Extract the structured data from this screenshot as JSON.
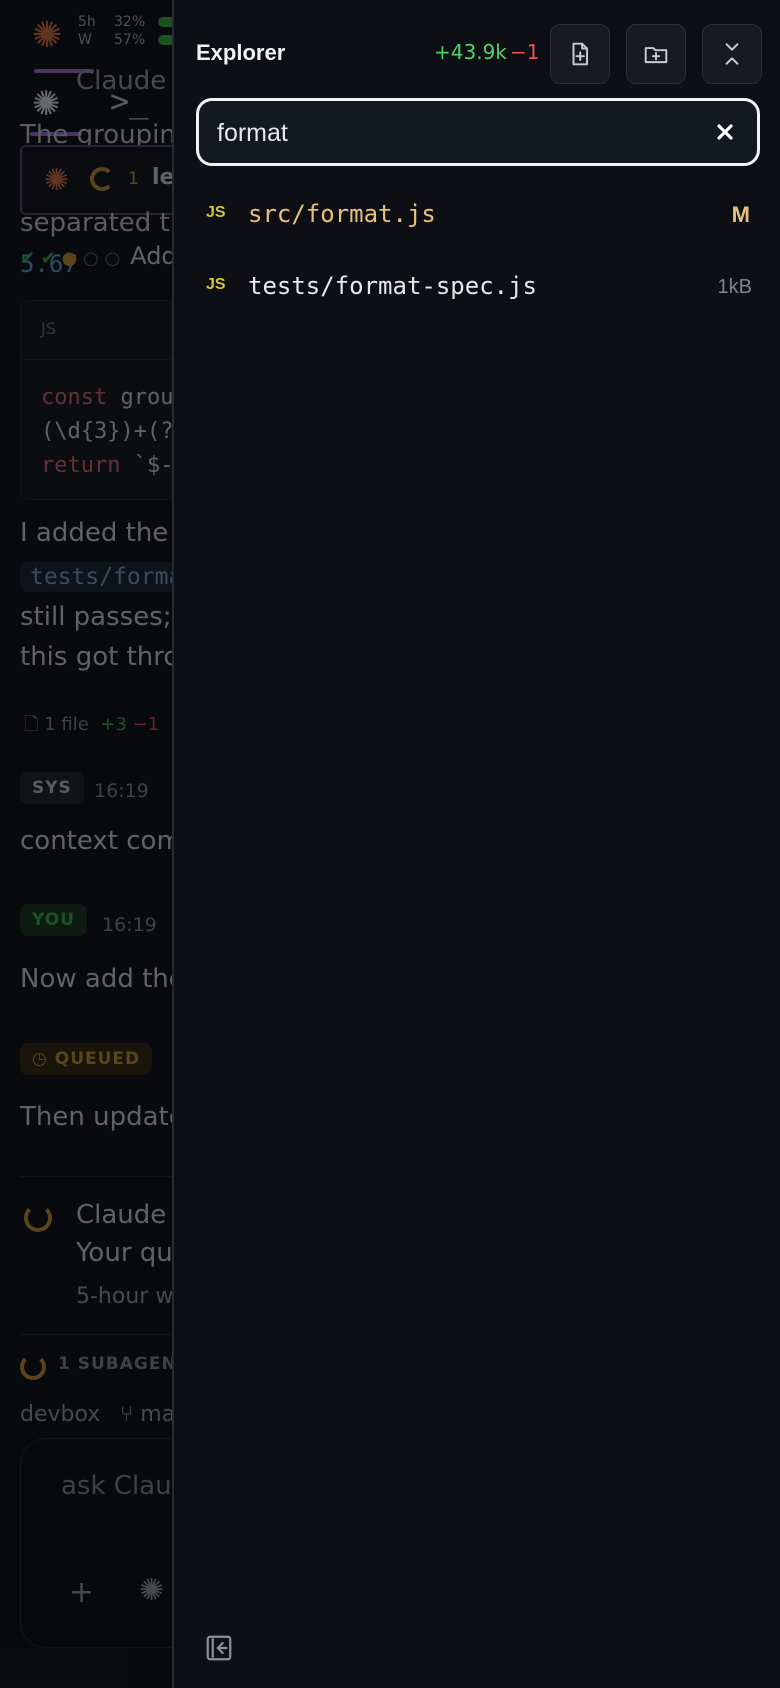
{
  "background": {
    "usage": [
      {
        "label": "5h",
        "percent": "32%"
      },
      {
        "label": "W",
        "percent": "57%"
      }
    ],
    "snippets": {
      "header_partial": "Claude c",
      "line_grouping": "The groupin",
      "line_separated": "separated th",
      "task_label": "Add",
      "number_tail": "5.67",
      "code_lang": "JS",
      "code_line1_kw": "const",
      "code_line1_rest": " grou",
      "code_line2": "(\\d{3})+(?",
      "code_line3_kw": "return",
      "code_line3_rest": " `$-",
      "para1": "I added the",
      "inline_code": "tests/forma",
      "para2": "still passes;",
      "para3": "this got thro",
      "file_count": "1 file",
      "file_added": "+3",
      "file_removed": "−1",
      "sys_badge": "SYS",
      "sys_time": "16:19",
      "sys_text": "context com",
      "you_badge": "YOU",
      "you_time": "16:19",
      "you_text": "Now add the",
      "queued_badge": "◷ QUEUED",
      "queued_text": "Then update",
      "claude_name": "Claude",
      "claude_status": "Your qu",
      "claude_window": "5-hour w",
      "subagents": "1 SUBAGENT",
      "host": "devbox",
      "branch": "⑂ ma",
      "input_placeholder": "ask Claud",
      "card_count": "1",
      "card_label": "le"
    }
  },
  "explorer": {
    "title": "Explorer",
    "lines_added": "+43.9k",
    "lines_removed": "−1",
    "search_value": "format",
    "files": [
      {
        "type": "JS",
        "path": "src/format.js",
        "status": "M",
        "size": "",
        "path_color": "#e7c17a"
      },
      {
        "type": "JS",
        "path": "tests/format-spec.js",
        "status": "",
        "size": "1kB",
        "path_color": "#e6e8ec"
      }
    ]
  }
}
